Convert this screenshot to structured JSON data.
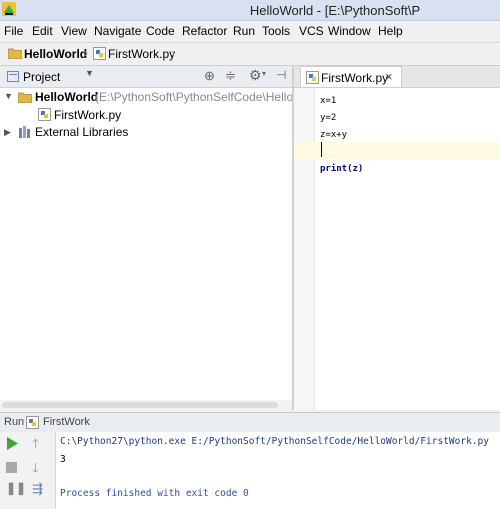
{
  "window": {
    "title": "HelloWorld - [E:\\PythonSoft\\P"
  },
  "menu": {
    "items": [
      "File",
      "Edit",
      "View",
      "Navigate",
      "Code",
      "Refactor",
      "Run",
      "Tools",
      "VCS",
      "Window",
      "Help"
    ]
  },
  "navbar": {
    "project": "HelloWorld",
    "file": "FirstWork.py"
  },
  "project_panel": {
    "title": "Project",
    "root_name": "HelloWorld",
    "root_path": "(E:\\PythonSoft\\PythonSelfCode\\HelloWorl",
    "file": "FirstWork.py",
    "external": "External Libraries"
  },
  "editor": {
    "tab_label": "FirstWork.py",
    "close_glyph": "×",
    "lines": [
      "x=1",
      "y=2",
      "z=x+y",
      "",
      "print(z)"
    ]
  },
  "run_panel": {
    "run_label": "Run",
    "config_name": "FirstWork",
    "console": {
      "command": "C:\\Python27\\python.exe E:/PythonSoft/PythonSelfCode/HelloWorld/FirstWork.py",
      "output": "3",
      "exit": "Process finished with exit code 0"
    }
  },
  "colors": {
    "accent": "#2f65ca",
    "keyword": "#000080",
    "console_cmd": "#1e3a8a",
    "console_exit": "#2a4fb4",
    "run_green": "#3ea637",
    "folder_yellow": "#e0b54a"
  }
}
